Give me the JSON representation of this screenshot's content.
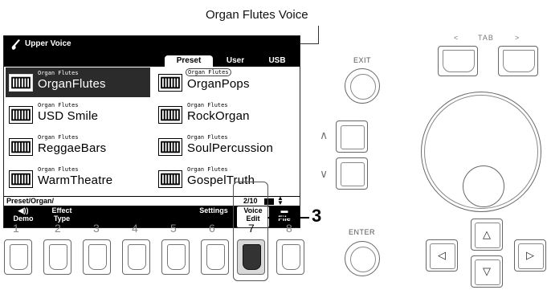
{
  "callout": {
    "title": "Organ Flutes Voice",
    "step": "3"
  },
  "screen": {
    "title": "Upper Voice",
    "tabs": [
      {
        "label": "Preset",
        "active": true
      },
      {
        "label": "User",
        "active": false
      },
      {
        "label": "USB",
        "active": false
      }
    ],
    "voices": [
      {
        "category": "Organ Flutes",
        "name": "OrganFlutes",
        "selected": true
      },
      {
        "category": "Organ Flutes",
        "name": "OrganPops",
        "selected": false
      },
      {
        "category": "Organ Flutes",
        "name": "USD Smile",
        "selected": false
      },
      {
        "category": "Organ Flutes",
        "name": "RockOrgan",
        "selected": false
      },
      {
        "category": "Organ Flutes",
        "name": "ReggaeBars",
        "selected": false
      },
      {
        "category": "Organ Flutes",
        "name": "SoulPercussion",
        "selected": false
      },
      {
        "category": "Organ Flutes",
        "name": "WarmTheatre",
        "selected": false
      },
      {
        "category": "Organ Flutes",
        "name": "GospelTruth",
        "selected": false
      }
    ],
    "status": {
      "path": "Preset/Organ/",
      "page": "2/10"
    },
    "functions": [
      {
        "line1": "◀))",
        "line2": "Demo"
      },
      {
        "line1": "Effect",
        "line2": "Type"
      },
      {
        "line1": "",
        "line2": ""
      },
      {
        "line1": "",
        "line2": ""
      },
      {
        "line1": "",
        "line2": ""
      },
      {
        "line1": "",
        "line2": "Settings"
      },
      {
        "line1": "Voice",
        "line2": "Edit"
      },
      {
        "line1": "▬",
        "line2": "File"
      }
    ]
  },
  "buttons": {
    "numbers": [
      "1",
      "2",
      "3",
      "4",
      "5",
      "6",
      "7",
      "8"
    ],
    "pressed_index": 6,
    "exit_label": "EXIT",
    "enter_label": "ENTER",
    "tab_label": "TAB",
    "tab_left": "<",
    "tab_right": ">",
    "up": "∧",
    "down": "∨",
    "cursor_up": "△",
    "cursor_down": "▽",
    "cursor_left": "◁",
    "cursor_right": "▷"
  }
}
